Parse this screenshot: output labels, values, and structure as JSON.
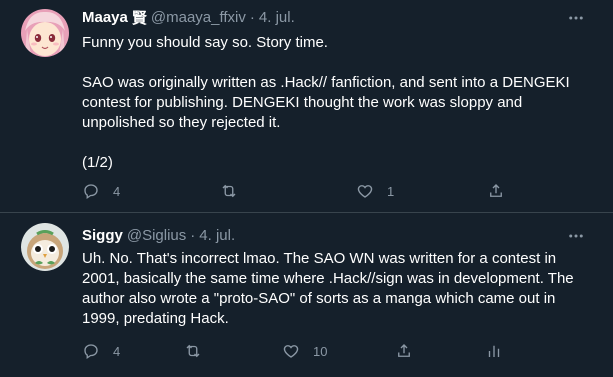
{
  "tweets": [
    {
      "name": "Maaya",
      "name_badge": "賢",
      "handle": "@maaya_ffxiv",
      "separator": "·",
      "date": "4. jul.",
      "text": [
        "Funny you should say so. Story time.",
        "",
        "SAO was originally written as .Hack// fanfiction, and sent into a DENGEKI contest for publishing. DENGEKI thought the work was sloppy and unpolished so they rejected it.",
        "",
        "(1/2)"
      ],
      "actions": {
        "reply_count": "4",
        "retweet_count": "",
        "like_count": "1",
        "share_count": ""
      },
      "avatar_icon": "anime-avatar-icon"
    },
    {
      "name": "Siggy",
      "handle": "@Siglius",
      "separator": "·",
      "date": "4. jul.",
      "text": [
        "Uh. No. That's incorrect lmao. The SAO WN was written for a contest in 2001, basically the same time where .Hack//sign was in development. The author also wrote a \"proto-SAO\" of sorts as a manga which came out in 1999, predating Hack."
      ],
      "actions": {
        "reply_count": "4",
        "retweet_count": "",
        "like_count": "10",
        "analytics_count": ""
      },
      "avatar_icon": "owl-avatar-icon"
    }
  ],
  "colors": {
    "background": "#15202b",
    "text": "#ffffff",
    "secondary": "#8b98a5",
    "divider": "#38444d"
  }
}
